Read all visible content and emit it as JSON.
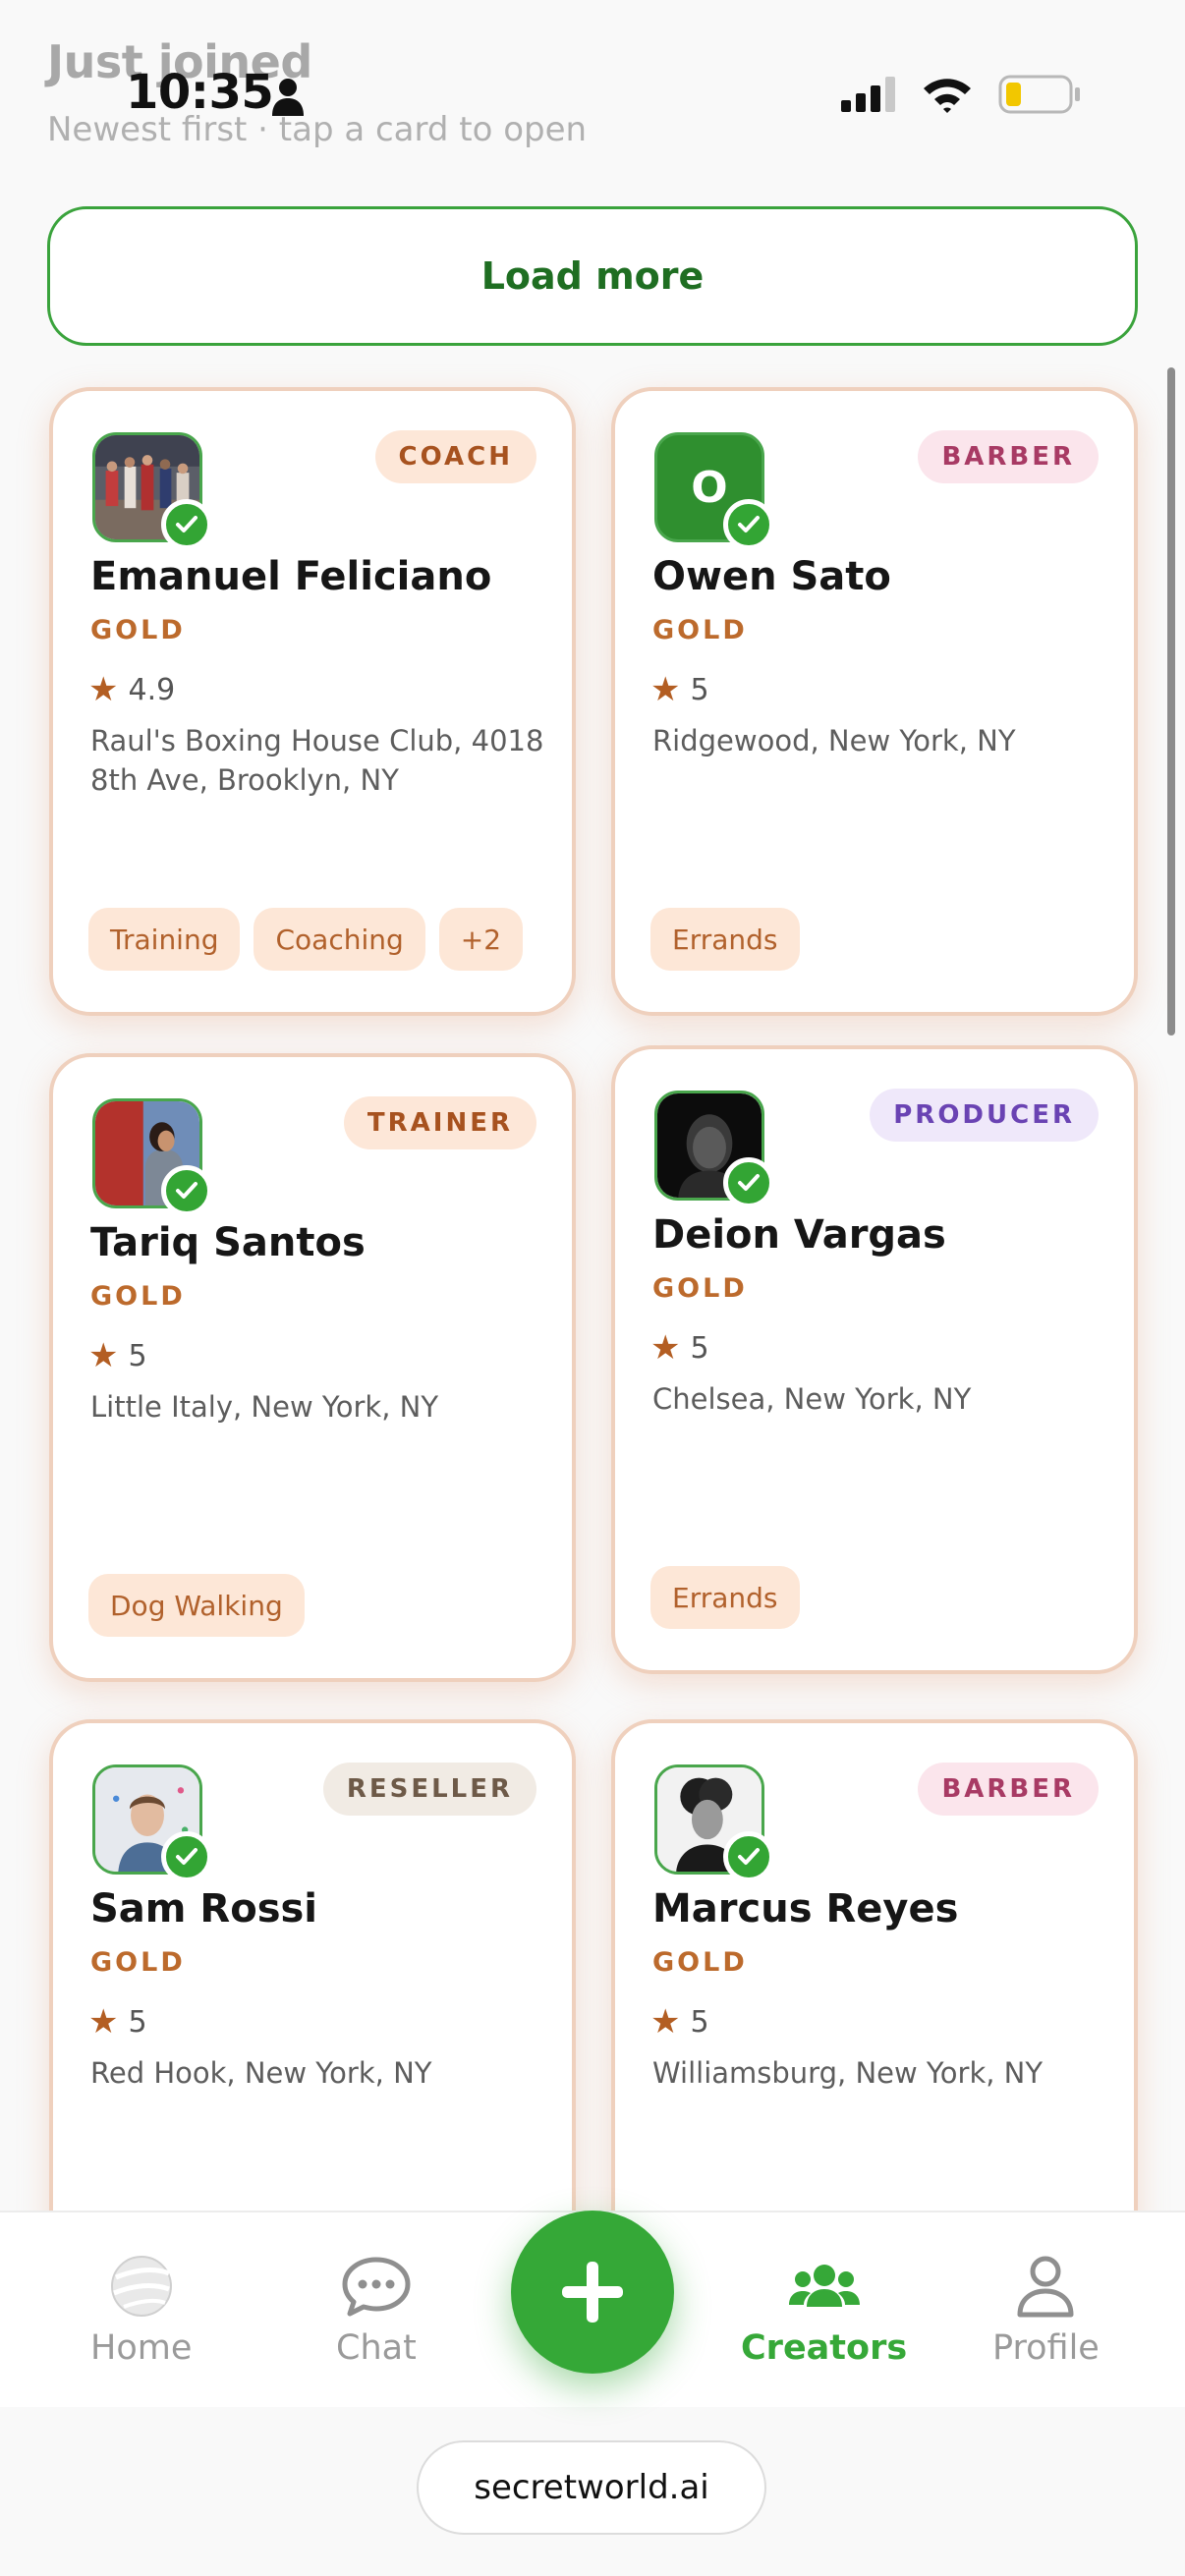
{
  "header": {
    "title": "Just joined",
    "subtitle": "Newest first · tap a card to open"
  },
  "status_bar": {
    "time": "10:35",
    "battery_level": 0.25
  },
  "load_more_label": "Load more",
  "creators": [
    {
      "name": "Emanuel Feliciano",
      "tier": "GOLD",
      "role": "COACH",
      "rating": "4.9",
      "location": "Raul's Boxing House Club, 4018 8th Ave, Brooklyn, NY",
      "tags": [
        "Training",
        "Coaching",
        "+2"
      ],
      "verified": true
    },
    {
      "name": "Owen Sato",
      "tier": "GOLD",
      "role": "BARBER",
      "rating": "5",
      "location": "Ridgewood, New York, NY",
      "tags": [
        "Errands"
      ],
      "avatar_initial": "O",
      "verified": true
    },
    {
      "name": "Tariq Santos",
      "tier": "GOLD",
      "role": "TRAINER",
      "rating": "5",
      "location": "Little Italy, New York, NY",
      "tags": [
        "Dog Walking"
      ],
      "verified": true
    },
    {
      "name": "Deion Vargas",
      "tier": "GOLD",
      "role": "PRODUCER",
      "rating": "5",
      "location": "Chelsea, New York, NY",
      "tags": [
        "Errands"
      ],
      "verified": true
    },
    {
      "name": "Sam Rossi",
      "tier": "GOLD",
      "role": "RESELLER",
      "rating": "5",
      "location": "Red Hook, New York, NY",
      "tags": [],
      "verified": true
    },
    {
      "name": "Marcus Reyes",
      "tier": "GOLD",
      "role": "BARBER",
      "rating": "5",
      "location": "Williamsburg, New York, NY",
      "tags": [],
      "verified": true
    }
  ],
  "nav": {
    "items": [
      {
        "label": "Home",
        "icon": "globe-icon"
      },
      {
        "label": "Chat",
        "icon": "chat-bubble-icon"
      },
      {
        "label": "Creators",
        "icon": "users-icon",
        "active": true
      },
      {
        "label": "Profile",
        "icon": "person-icon"
      }
    ],
    "fab_icon": "plus-icon"
  },
  "url": "secretworld.ai",
  "colors": {
    "accent_green": "#35a837",
    "gold": "#bc6a2c",
    "card_border": "#efd0bd"
  }
}
